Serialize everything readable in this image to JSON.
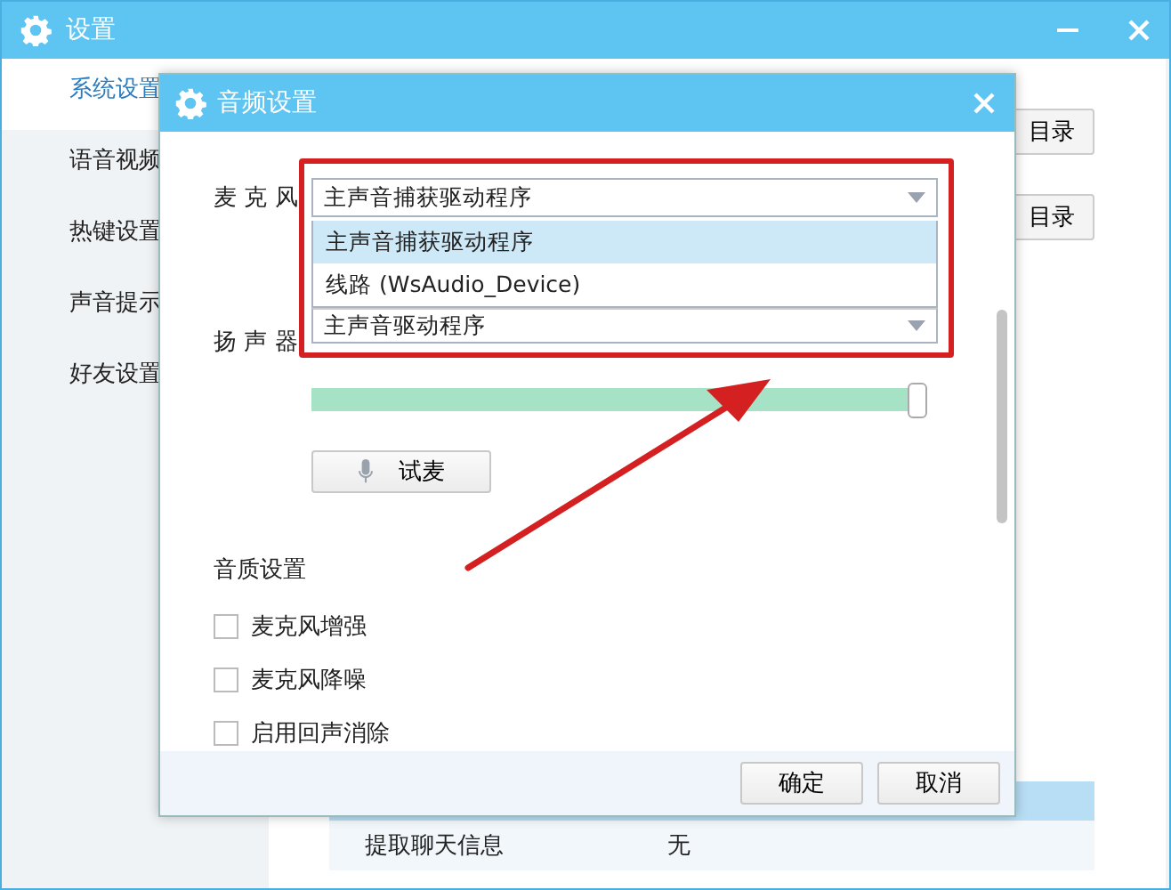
{
  "window": {
    "title": "设置"
  },
  "sidebar": {
    "items": [
      {
        "label": "系统设置",
        "selected": true
      },
      {
        "label": "语音视频",
        "selected": false
      },
      {
        "label": "热键设置",
        "selected": false
      },
      {
        "label": "声音提示",
        "selected": false
      },
      {
        "label": "好友设置",
        "selected": false
      }
    ]
  },
  "background": {
    "buttons": [
      "目录",
      "目录"
    ],
    "table": {
      "rows": [
        [
          "提取聊天信息",
          "无"
        ]
      ]
    }
  },
  "dialog": {
    "title": "音频设置",
    "microphone": {
      "label": "麦 克 风",
      "value": "主声音捕获驱动程序",
      "options": [
        {
          "label": "主声音捕获驱动程序",
          "selected": true
        },
        {
          "label": "线路 (WsAudio_Device)",
          "selected": false
        }
      ]
    },
    "speaker": {
      "label": "扬 声 器",
      "value": "主声音驱动程序",
      "level": 0.97
    },
    "test_button": "试麦",
    "quality": {
      "heading": "音质设置",
      "options": [
        {
          "label": "麦克风增强",
          "checked": false
        },
        {
          "label": "麦克风降噪",
          "checked": false
        },
        {
          "label": "启用回声消除",
          "checked": false
        }
      ]
    },
    "buttons": [
      "确定",
      "取消"
    ]
  }
}
